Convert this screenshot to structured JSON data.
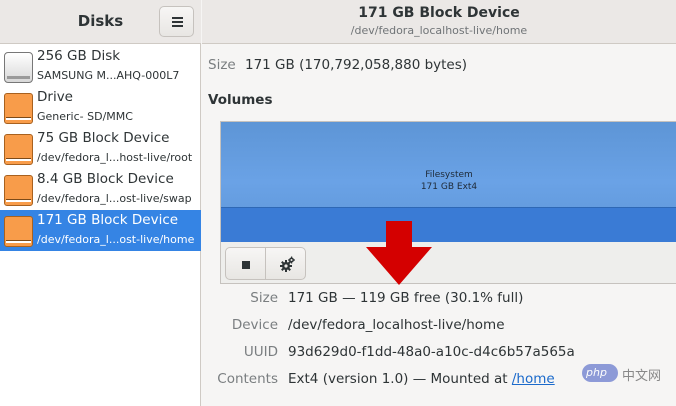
{
  "sidebar": {
    "title": "Disks",
    "items": [
      {
        "name": "256 GB Disk",
        "sub": "SAMSUNG M...AHQ-000L7",
        "icon": "hard-disk-icon",
        "selected": false
      },
      {
        "name": "Drive",
        "sub": "Generic- SD/MMC",
        "icon": "drive-icon",
        "selected": false
      },
      {
        "name": "75 GB Block Device",
        "sub": "/dev/fedora_l...host-live/root",
        "icon": "block-device-icon",
        "selected": false
      },
      {
        "name": "8.4 GB Block Device",
        "sub": "/dev/fedora_l...ost-live/swap",
        "icon": "block-device-icon",
        "selected": false
      },
      {
        "name": "171 GB Block Device",
        "sub": "/dev/fedora_l...ost-live/home",
        "icon": "block-device-icon",
        "selected": true
      }
    ]
  },
  "header": {
    "title": "171 GB Block Device",
    "subtitle": "/dev/fedora_localhost-live/home"
  },
  "main": {
    "size_label": "Size",
    "size_value": "171 GB (170,792,058,880 bytes)",
    "volumes_heading": "Volumes",
    "partition": {
      "label": "Filesystem",
      "sub": "171 GB Ext4"
    },
    "details": {
      "size": {
        "label": "Size",
        "value": "171 GB — 119 GB free (30.1% full)"
      },
      "device": {
        "label": "Device",
        "value": "/dev/fedora_localhost-live/home"
      },
      "uuid": {
        "label": "UUID",
        "value": "93d629d0-f1dd-48a0-a10c-d4c6b57a565a"
      },
      "contents": {
        "label": "Contents",
        "value_prefix": "Ext4 (version 1.0) — Mounted at ",
        "mount_point": "/home"
      }
    }
  },
  "watermark": {
    "logo_text": "php",
    "text": "中文网"
  },
  "colors": {
    "selection": "#3584e4",
    "partition": "#6aa2e6",
    "arrow": "#d40000",
    "block_icon": "#f89c4a"
  }
}
